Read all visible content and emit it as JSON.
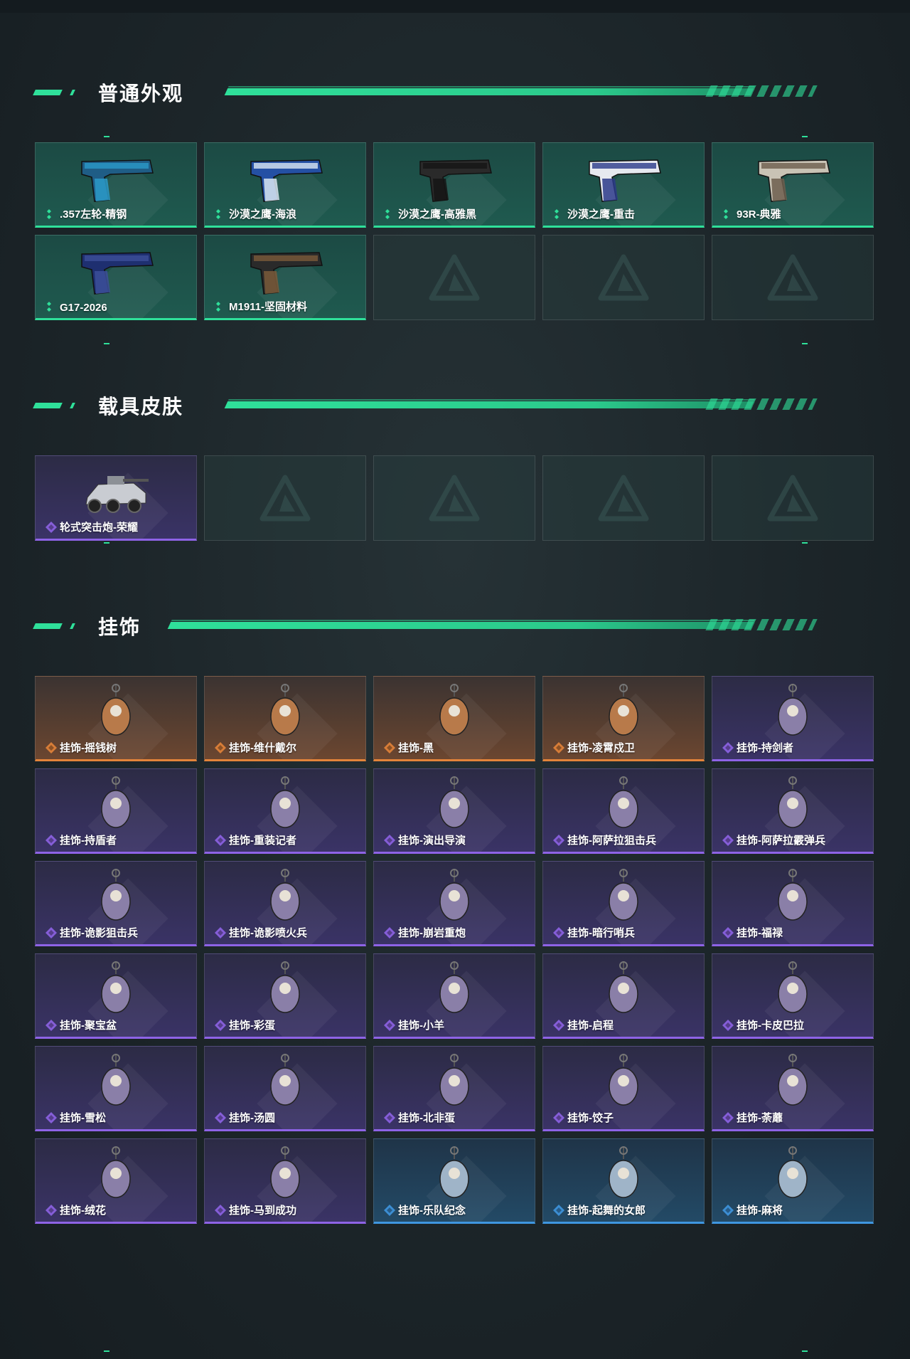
{
  "sections": [
    {
      "title": "普通外观",
      "items": [
        {
          "label": ".357左轮-精钢",
          "rarity": "green",
          "icon": "revolver"
        },
        {
          "label": "沙漠之鹰-海浪",
          "rarity": "green",
          "icon": "pistol-blue"
        },
        {
          "label": "沙漠之鹰-高雅黑",
          "rarity": "green",
          "icon": "pistol-black"
        },
        {
          "label": "沙漠之鹰-重击",
          "rarity": "green",
          "icon": "pistol-white"
        },
        {
          "label": "93R-典雅",
          "rarity": "green",
          "icon": "pistol-silver"
        },
        {
          "label": "G17-2026",
          "rarity": "green",
          "icon": "pistol-navy"
        },
        {
          "label": "M1911-坚固材料",
          "rarity": "green",
          "icon": "pistol-brown"
        },
        {
          "label": "",
          "rarity": "empty"
        },
        {
          "label": "",
          "rarity": "empty"
        },
        {
          "label": "",
          "rarity": "empty"
        }
      ]
    },
    {
      "title": "载具皮肤",
      "items": [
        {
          "label": "轮式突击炮-荣耀",
          "rarity": "purple",
          "icon": "vehicle"
        },
        {
          "label": "",
          "rarity": "empty"
        },
        {
          "label": "",
          "rarity": "empty"
        },
        {
          "label": "",
          "rarity": "empty"
        },
        {
          "label": "",
          "rarity": "empty"
        }
      ]
    },
    {
      "title": "挂饰",
      "items": [
        {
          "label": "挂饰-摇钱树",
          "rarity": "orange",
          "icon": "charm"
        },
        {
          "label": "挂饰-维什戴尔",
          "rarity": "orange",
          "icon": "charm"
        },
        {
          "label": "挂饰-黑",
          "rarity": "orange",
          "icon": "charm"
        },
        {
          "label": "挂饰-凌霄戍卫",
          "rarity": "orange",
          "icon": "charm"
        },
        {
          "label": "挂饰-持剑者",
          "rarity": "purple",
          "icon": "charm"
        },
        {
          "label": "挂饰-持盾者",
          "rarity": "purple",
          "icon": "charm"
        },
        {
          "label": "挂饰-重装记者",
          "rarity": "purple",
          "icon": "charm"
        },
        {
          "label": "挂饰-演出导演",
          "rarity": "purple",
          "icon": "charm"
        },
        {
          "label": "挂饰-阿萨拉狙击兵",
          "rarity": "purple",
          "icon": "charm"
        },
        {
          "label": "挂饰-阿萨拉霰弹兵",
          "rarity": "purple",
          "icon": "charm"
        },
        {
          "label": "挂饰-诡影狙击兵",
          "rarity": "purple",
          "icon": "charm"
        },
        {
          "label": "挂饰-诡影喷火兵",
          "rarity": "purple",
          "icon": "charm"
        },
        {
          "label": "挂饰-崩岩重炮",
          "rarity": "purple",
          "icon": "charm"
        },
        {
          "label": "挂饰-暗行哨兵",
          "rarity": "purple",
          "icon": "charm"
        },
        {
          "label": "挂饰-福禄",
          "rarity": "purple",
          "icon": "charm"
        },
        {
          "label": "挂饰-聚宝盆",
          "rarity": "purple",
          "icon": "charm"
        },
        {
          "label": "挂饰-彩蛋",
          "rarity": "purple",
          "icon": "charm"
        },
        {
          "label": "挂饰-小羊",
          "rarity": "purple",
          "icon": "charm"
        },
        {
          "label": "挂饰-启程",
          "rarity": "purple",
          "icon": "charm"
        },
        {
          "label": "挂饰-卡皮巴拉",
          "rarity": "purple",
          "icon": "charm"
        },
        {
          "label": "挂饰-雪松",
          "rarity": "purple",
          "icon": "charm"
        },
        {
          "label": "挂饰-汤圆",
          "rarity": "purple",
          "icon": "charm"
        },
        {
          "label": "挂饰-北非蛋",
          "rarity": "purple",
          "icon": "charm"
        },
        {
          "label": "挂饰-饺子",
          "rarity": "purple",
          "icon": "charm"
        },
        {
          "label": "挂饰-荼蘼",
          "rarity": "purple",
          "icon": "charm"
        },
        {
          "label": "挂饰-绒花",
          "rarity": "purple",
          "icon": "charm"
        },
        {
          "label": "挂饰-马到成功",
          "rarity": "purple",
          "icon": "charm"
        },
        {
          "label": "挂饰-乐队纪念",
          "rarity": "blue",
          "icon": "charm"
        },
        {
          "label": "挂饰-起舞的女郎",
          "rarity": "blue",
          "icon": "charm"
        },
        {
          "label": "挂饰-麻将",
          "rarity": "blue",
          "icon": "charm"
        }
      ]
    }
  ],
  "colors": {
    "accent": "#2fe09a",
    "green": "#2fe09a",
    "purple": "#8e63e6",
    "orange": "#e3843a",
    "blue": "#3f96e0"
  }
}
